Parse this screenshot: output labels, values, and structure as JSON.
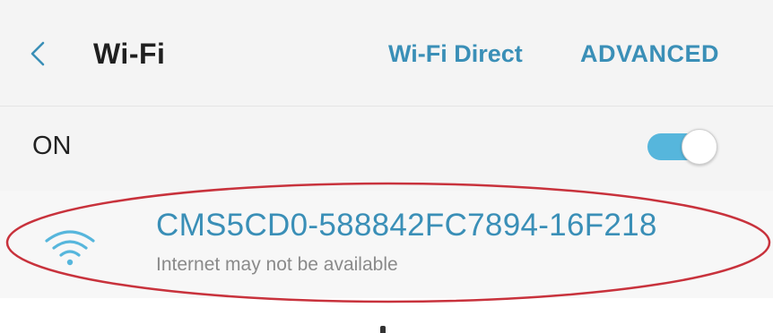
{
  "header": {
    "back_icon": "chevron-left-icon",
    "title": "Wi-Fi",
    "wifi_direct_label": "Wi-Fi Direct",
    "advanced_label": "ADVANCED"
  },
  "master_switch": {
    "label": "ON",
    "state": "on",
    "accent_color": "#56b6dc"
  },
  "networks": [
    {
      "ssid": "CMS5CD0-588842FC7894-16F218",
      "status": "Internet may not be available",
      "icon": "wifi-signal-icon"
    }
  ],
  "colors": {
    "accent": "#3a8fb7",
    "annotation": "#c8323c"
  }
}
